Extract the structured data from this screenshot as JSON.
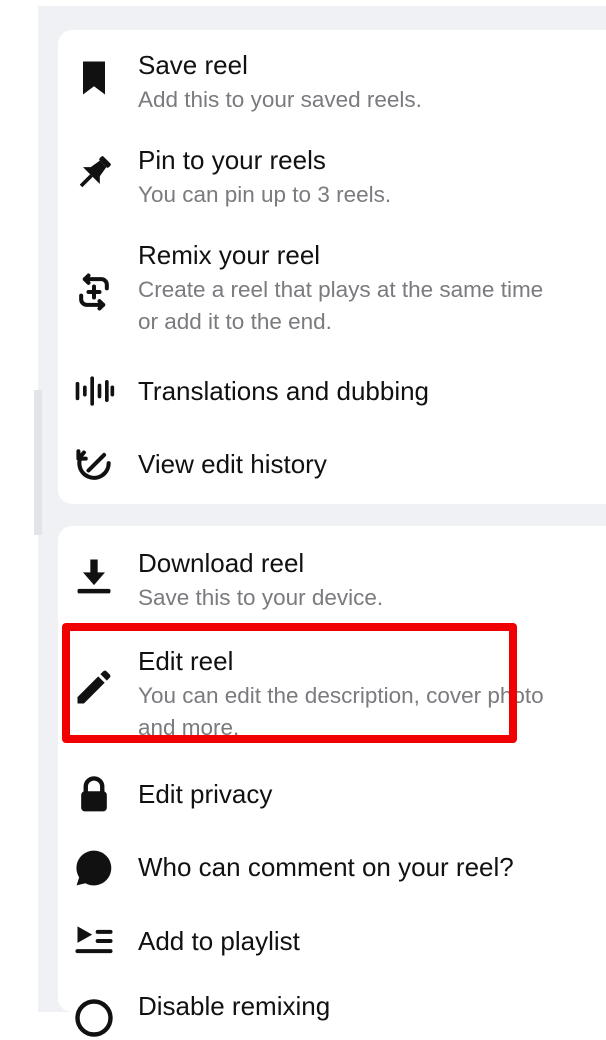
{
  "sections": [
    {
      "items": [
        {
          "title": "Save reel",
          "subtitle": "Add this to your saved reels.",
          "icon": "bookmark-icon"
        },
        {
          "title": "Pin to your reels",
          "subtitle": "You can pin up to 3 reels.",
          "icon": "pin-icon"
        },
        {
          "title": "Remix your reel",
          "subtitle": "Create a reel that plays at the same time",
          "subtitle2": "or add it to the end.",
          "icon": "remix-icon"
        },
        {
          "title": "Translations and dubbing",
          "icon": "audio-waveform-icon"
        },
        {
          "title": "View edit history",
          "icon": "edit-history-icon"
        }
      ]
    },
    {
      "items": [
        {
          "title": "Download reel",
          "subtitle": "Save this to your device.",
          "icon": "download-icon"
        },
        {
          "title": "Edit reel",
          "subtitle": "You can edit the description, cover photo",
          "subtitle2": "and more.",
          "icon": "pencil-icon"
        },
        {
          "title": "Edit privacy",
          "icon": "lock-icon"
        },
        {
          "title": "Who can comment on your reel?",
          "icon": "comment-icon"
        },
        {
          "title": "Add to playlist",
          "icon": "playlist-icon"
        },
        {
          "title": "Disable remixing",
          "icon": "remix-disable-icon"
        }
      ]
    }
  ],
  "highlight_color": "#f00000"
}
